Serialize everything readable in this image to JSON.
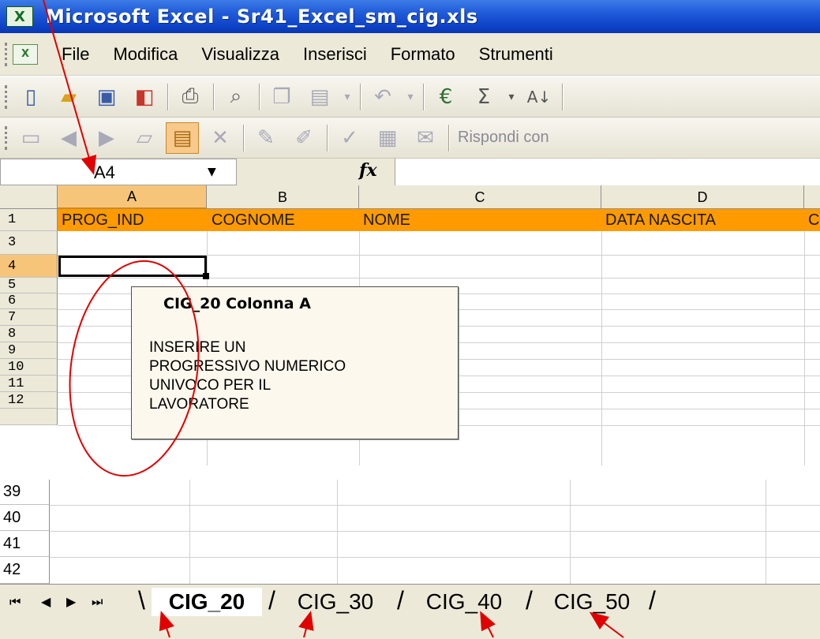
{
  "window": {
    "app_icon": "excel-icon",
    "title": "Microsoft Excel - Sr41_Excel_sm_cig.xls"
  },
  "menubar": {
    "items": [
      "File",
      "Modifica",
      "Visualizza",
      "Inserisci",
      "Formato",
      "Strumenti"
    ]
  },
  "toolbar_standard": {
    "icons": [
      "new-icon",
      "open-icon",
      "save-icon",
      "permission-icon",
      "print-icon",
      "print-preview-icon",
      "copy-icon",
      "paste-icon",
      "undo-icon",
      "euro-icon",
      "autosum-icon",
      "sort-ascending-icon"
    ]
  },
  "toolbar_review": {
    "icons": [
      "review-icon-1",
      "review-icon-2",
      "review-icon-3",
      "review-icon-4",
      "review-icon-5",
      "review-icon-6",
      "review-icon-7",
      "review-icon-8",
      "review-icon-9",
      "review-icon-10",
      "review-icon-11"
    ],
    "reply_label": "Rispondi con"
  },
  "formula_bar": {
    "name_box": "A4",
    "fx_label": "fx",
    "formula": ""
  },
  "columns": [
    "A",
    "B",
    "C",
    "D"
  ],
  "rows_top": [
    "1",
    "3",
    "4",
    "5",
    "6",
    "7",
    "8",
    "9",
    "10",
    "11",
    "12"
  ],
  "row1_headers": [
    "PROG_IND",
    "COGNOME",
    "NOME",
    "DATA NASCITA",
    "C"
  ],
  "active_cell": "A4",
  "comment": {
    "title": "CIG_20   Colonna A",
    "body": "INSERIRE UN\nPROGRESSIVO NUMERICO\nUNIVOCO PER IL\nLAVORATORE"
  },
  "rows_bottom": [
    "39",
    "40",
    "41",
    "42"
  ],
  "sheet_tabs": [
    "CIG_20",
    "CIG_30",
    "CIG_40",
    "CIG_50"
  ],
  "active_sheet": "CIG_20",
  "colors": {
    "title_bar": "#0b3fc4",
    "header_fill": "#ff9a00",
    "selected_header": "#f7c57a",
    "annotation": "#e00000"
  }
}
